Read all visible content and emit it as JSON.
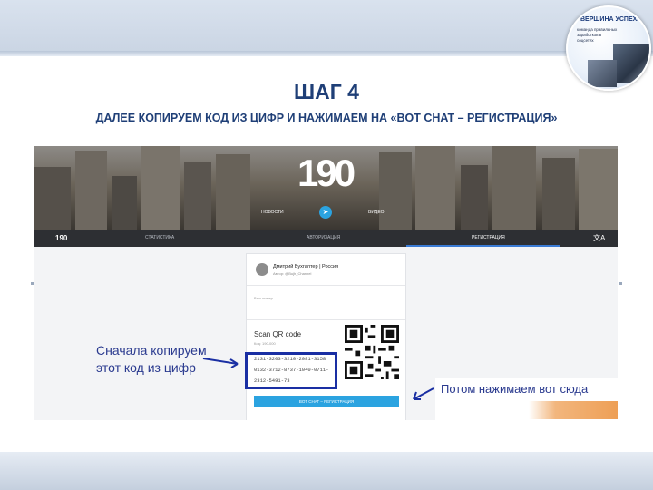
{
  "slide": {
    "step_title": "ШАГ 4",
    "subtitle": "ДАЛЕЕ КОПИРУЕМ КОД ИЗ ЦИФР И НАЖИМАЕМ НА «BOT CHAT – РЕГИСТРАЦИЯ»",
    "logo_title": "ВЕРШИНА УСПЕХА",
    "logo_subtitle": "команда правильных заработков в соцсетях"
  },
  "site": {
    "brand": "190",
    "hero_links": [
      "НОВОСТИ",
      "ВИДЕО"
    ],
    "nav_logo": "190",
    "nav_items": [
      "СТАТИСТИКА",
      "АВТОРИЗАЦИЯ",
      "РЕГИСТРАЦИЯ"
    ],
    "nav_active": "РЕГИСТРАЦИЯ",
    "lang_icon": "translate-icon"
  },
  "card": {
    "user_name": "Дмитрий Бухгалтер | Россия",
    "user_sub": "Автор: @Bujh_Channel",
    "field_label": "Ваш номер",
    "qr_title": "Scan QR code",
    "qr_sub": "Код: 190-000",
    "code_lines": [
      "2131-3203-3210-2081-3158",
      "0132-3712-8737-1040-0711-",
      "2312-5491-73"
    ],
    "bot_button": "BOT CHAT – РЕГИСТРАЦИЯ"
  },
  "annotations": {
    "left_line1": "Сначала копируем",
    "left_line2": "этот код из цифр",
    "right": "Потом нажимаем вот сюда",
    "color": "#1a2fa3"
  },
  "colors": {
    "heading": "#1f3f77",
    "telegram": "#2ba3e0",
    "accent_orange": "#ee9f55"
  }
}
